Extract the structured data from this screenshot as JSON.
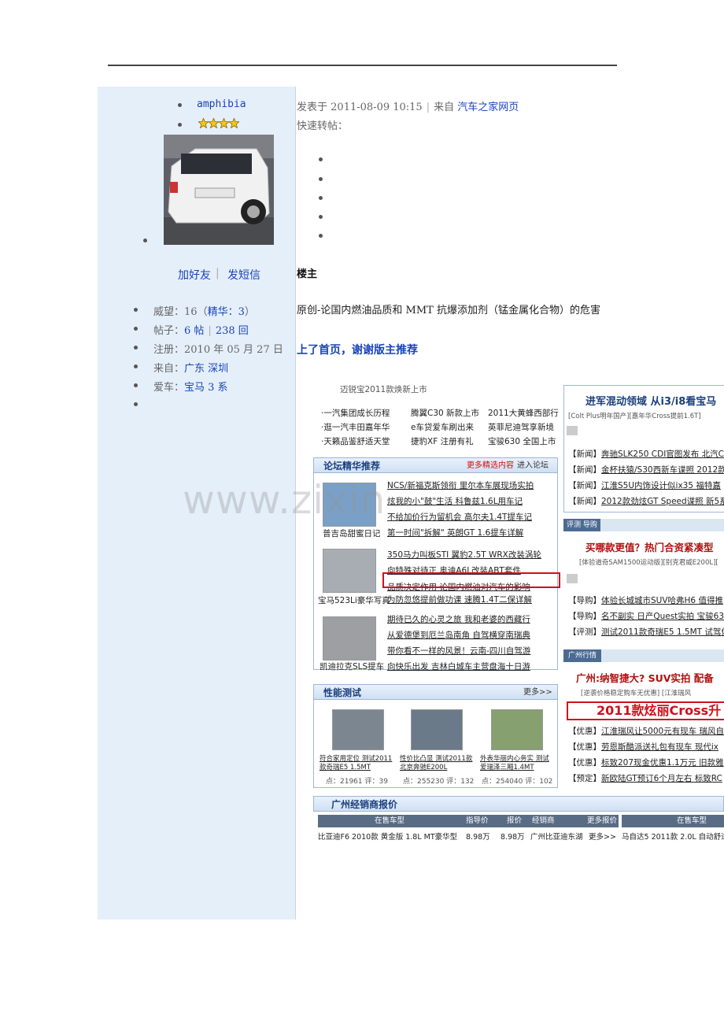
{
  "profile": {
    "username": "amphibia",
    "add_friend": "加好友",
    "send_message": "发短信",
    "stats": [
      {
        "label": "威望：",
        "value": "16",
        "extra_label": "精华：",
        "extra_value": "3"
      },
      {
        "label": "帖子：",
        "value": "6 帖",
        "value2": "238 回"
      },
      {
        "label": "注册：",
        "value": "2010 年 05 月 27 日"
      },
      {
        "label": "来自：",
        "value": "广东  深圳"
      },
      {
        "label": "爱车：",
        "value": "宝马 3 系"
      }
    ]
  },
  "post": {
    "posted_at_label": "发表于",
    "posted_at": "2011-08-09 10:15",
    "from_label": "来自",
    "from_source": "汽车之家网页",
    "quick_repost": "快速转帖：",
    "floor": "楼主",
    "title": "原创-论国内燃油品质和 MMT 抗爆添加剂（锰金属化合物）的危害",
    "highlight": "上了首页，谢谢版主推荐"
  },
  "watermark": "www.zixin",
  "screenshot": {
    "top_left_lines": [
      [
        "·一汽集团成长历程",
        "腾翼C30 新款上市",
        "2011大黄蜂西部行"
      ],
      [
        "·逛一汽丰田嘉年华",
        "e车贷爱车刷出来",
        "英菲尼迪驾享新境"
      ],
      [
        "·天籁品鉴舒适天堂",
        "捷豹XF 注册有礼",
        "宝骏630 全国上市"
      ]
    ],
    "top_left_caption": "迈锐宝2011款焕新上市",
    "forum_title": "论坛精华推荐",
    "forum_more": "更多精选内容",
    "forum_enter": "进入论坛",
    "forum_groups": [
      {
        "caption": "普吉岛甜蜜日记",
        "items": [
          "NCS/新福克斯领衔 里尔本车展现场实拍",
          "炫我的小\"鼓\"生活 科鲁兹1.6L用车记",
          "不给加价行为留机会 高尔夫1.4T提车记",
          "第一时间\"拆解\" 英朗GT 1.6提车详解"
        ]
      },
      {
        "caption": "宝马523Li豪华写真",
        "items": [
          "350马力叫板STI 翼豹2.5T WRX改装涡轮",
          "向特殊对待正 奥迪A6L改装ABT套件",
          "品质决定作用 论国内燃油对汽车的影响",
          "为防忽悠提前做功课 速腾1.4T二保详解"
        ]
      },
      {
        "caption": "凯迪拉克SLS提车",
        "items": [
          "期待已久的心灵之旅 我和老婆的西藏行",
          "从爱德堡到厄兰岛南角 自驾横穿南瑞典",
          "带你看不一样的风景！云南-四川自驾游",
          "向快乐出发 吉林白城车主营盘海十日游"
        ]
      }
    ],
    "perf_title": "性能测试",
    "perf_more": "更多>>",
    "perf_items": [
      {
        "caption": "符合家用定位 测试2011款奇瑞E5 1.5MT",
        "stats": "点：21961 评：39"
      },
      {
        "caption": "性价比凸显 测试2011款北京奔驰E200L",
        "stats": "点：255230 评：132"
      },
      {
        "caption": "外表华丽内心务实 测试爱瑞泽三厢1.4MT",
        "stats": "点：254040 评：102"
      }
    ],
    "dealer_title": "广州经销商报价",
    "dealer_headers": [
      "在售车型",
      "指导价",
      "报价",
      "经销商",
      "更多报价"
    ],
    "dealer_row": [
      "比亚迪F6 2010款 黄金版 1.8L MT豪华型",
      "8.98万",
      "8.98万",
      "广州比亚迪东湖",
      "更多>>"
    ],
    "dealer_right_header": "在售车型",
    "dealer_right_row": "马自达5 2011款 2.0L 自动舒适",
    "right_headline1": "进军混动领域 从i3/i8看宝马",
    "right_sub1": "[Colt Plus明年国产][嘉年华Cross提前1.6T]",
    "right_news": [
      [
        "【新闻】",
        "奔驰SLK250 CDI官图发布 北汽C7"
      ],
      [
        "【新闻】",
        "金杯扶猿/S30西新车谍照 2012款"
      ],
      [
        "【新闻】",
        "江淮S5U内饰设计似ix35 福特嘉"
      ],
      [
        "【新闻】",
        "2012款劲炫GT Speed谍照 新5系"
      ]
    ],
    "tab1": "评测",
    "tab2": "导购",
    "right_headline2": "买哪款更值？热门合资紧凑型",
    "right_sub2": "[体验道奇SAM1500运动版][别克君威E200L][",
    "right_guides": [
      [
        "【导购】",
        "体验长城城市SUV哈弗H6 值得推"
      ],
      [
        "【导购】",
        "名不副实 日产Quest实拍 宝骏63"
      ],
      [
        "【评测】",
        "测试2011款奇瑞E5 1.5MT 试驾体"
      ]
    ],
    "city_tab": "广州行情",
    "right_headline3": "广州:纳智捷大? SUV实拍 配备",
    "right_sub3": "[逆袭价格稳定购车无优惠] [江淮瑞风",
    "banner_text": "2011款炫丽Cross升",
    "right_deals": [
      [
        "【优惠】",
        "江淮瑞风让5000元有现车 瑞风自"
      ],
      [
        "【优惠】",
        "劳恩斯酷派送礼包有现车 现代ix"
      ],
      [
        "【优惠】",
        "标致207现金优惠1.1万元 旧款雅"
      ],
      [
        "【预定】",
        "新欧陆GT预订6个月左右 标致RC"
      ]
    ]
  },
  "colors": {
    "link": "#1a44b8",
    "sidebar_bg": "#e5effa",
    "highlight_box": "#d0101a"
  }
}
